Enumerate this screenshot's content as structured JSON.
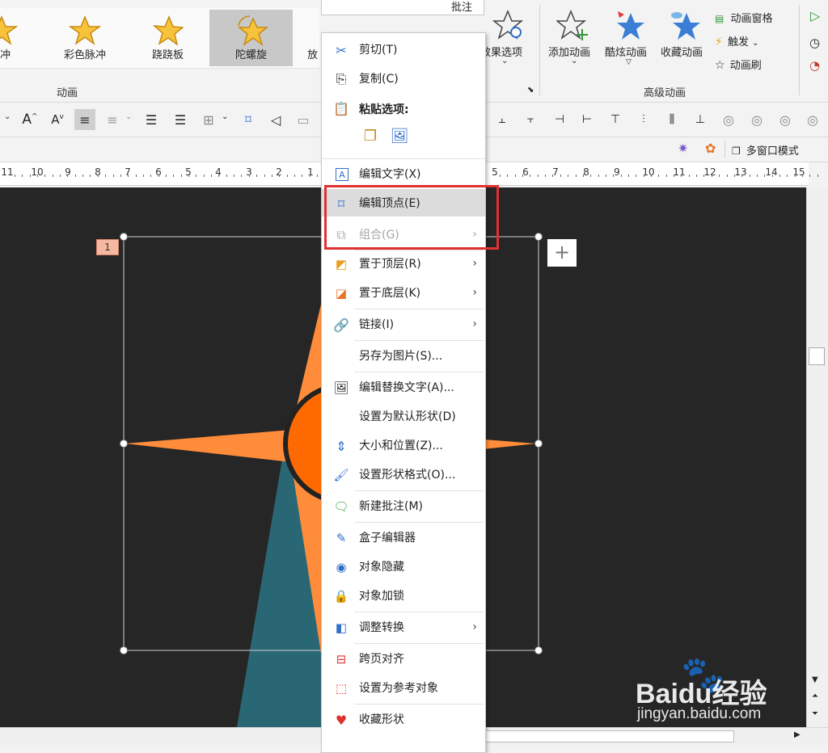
{
  "ribbon": {
    "animations_gallery": [
      {
        "label": "冲",
        "icon": "pulse-star-icon"
      },
      {
        "label": "彩色脉冲",
        "icon": "color-pulse-star-icon"
      },
      {
        "label": "跷跷板",
        "icon": "teeter-star-icon"
      },
      {
        "label": "陀螺旋",
        "icon": "spin-star-icon"
      },
      {
        "label": "放",
        "icon": "grow-star-icon"
      }
    ],
    "group_animation_label": "动画",
    "effect_options_label": "效果选项",
    "add_animation_label": "添加动画",
    "cool_animation_label": "酷炫动画",
    "fav_animation_label": "收藏动画",
    "anim_pane_label": "动画窗格",
    "trigger_label": "触发",
    "anim_brush_label": "动画刷",
    "group_advanced_label": "高级动画",
    "top_tab_fragment": "批注"
  },
  "strip": {
    "multiwindow_label": "多窗口模式"
  },
  "ruler": {
    "left_labels": [
      "11",
      "10",
      "9",
      "8",
      "7",
      "6",
      "5",
      "4",
      "3",
      "2",
      "1"
    ],
    "right_labels": [
      "5",
      "6",
      "7",
      "8",
      "9",
      "10",
      "11",
      "12",
      "13",
      "14",
      "15"
    ]
  },
  "slide": {
    "animation_badge": "1",
    "add_button_symbol": "+"
  },
  "context_menu": {
    "cut": "剪切(T)",
    "copy": "复制(C)",
    "paste_options": "粘贴选项:",
    "edit_text": "编辑文字(X)",
    "edit_points": "编辑顶点(E)",
    "group": "组合(G)",
    "bring_front": "置于顶层(R)",
    "send_back": "置于底层(K)",
    "link": "链接(I)",
    "save_as_picture": "另存为图片(S)...",
    "edit_alt_text": "编辑替换文字(A)...",
    "set_default_shape": "设置为默认形状(D)",
    "size_position": "大小和位置(Z)...",
    "format_shape": "设置形状格式(O)...",
    "new_comment": "新建批注(M)",
    "box_editor": "盒子编辑器",
    "hide_object": "对象隐藏",
    "lock_object": "对象加锁",
    "adjust_convert": "调整转换",
    "cross_page_align": "跨页对齐",
    "set_reference": "设置为参考对象",
    "favorite_shape": "收藏形状"
  },
  "watermark": {
    "brand": "Baidu经验",
    "url": "jingyan.baidu.com"
  },
  "colors": {
    "orange_star": "#ff8c3a",
    "teal_shape": "#2a6775",
    "canvas_bg": "#262626",
    "highlight_red": "#e03131"
  }
}
